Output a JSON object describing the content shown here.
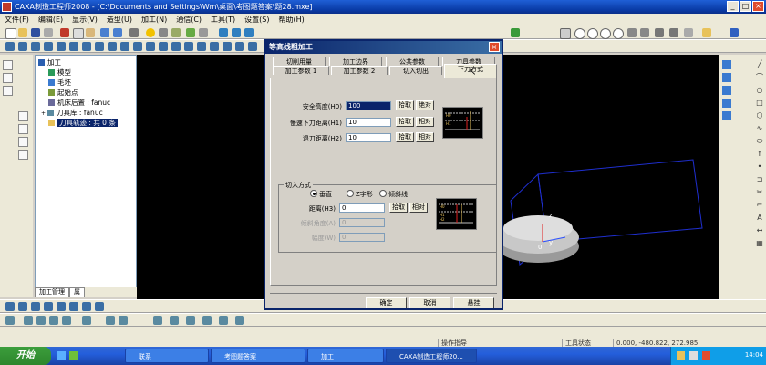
{
  "app": {
    "title": "CAXA制造工程师2008 - [C:\\Documents and Settings\\Wm\\桌面\\考图题答案\\题28.mxe]",
    "window_controls": [
      "_",
      "□",
      "×"
    ]
  },
  "menu": [
    "文件(F)",
    "编辑(E)",
    "显示(V)",
    "造型(U)",
    "加工(N)",
    "通信(C)",
    "工具(T)",
    "设置(S)",
    "帮助(H)"
  ],
  "tree": {
    "items": [
      {
        "label": "加工",
        "icon": "machining-icon"
      },
      {
        "label": "模型",
        "icon": "model-icon"
      },
      {
        "label": "毛坯",
        "icon": "stock-icon"
      },
      {
        "label": "起始点",
        "icon": "start-point-icon"
      },
      {
        "label": "机床后置 : fanuc",
        "icon": "machine-icon"
      },
      {
        "label": "刀具库 : fanuc",
        "icon": "tool-library-icon"
      },
      {
        "label": "刀具轨迹 : 共 0 条",
        "icon": "toolpath-icon"
      }
    ],
    "tabs": [
      "加工管理",
      "属"
    ]
  },
  "dialog": {
    "title": "等高线粗加工",
    "tabs_top": [
      "切削用量",
      "加工边界",
      "公共参数",
      "刀具参数"
    ],
    "tabs_bottom": [
      "加工参数 1",
      "加工参数 2",
      "切入切出",
      "下刀方式"
    ],
    "selected_tab": "下刀方式",
    "fields": [
      {
        "label": "安全高度(H0)",
        "value": "100",
        "buttons": [
          "拾取",
          "绝对"
        ]
      },
      {
        "label": "慢速下刀距离(H1)",
        "value": "10",
        "buttons": [
          "拾取",
          "相对"
        ]
      },
      {
        "label": "退刀距离(H2)",
        "value": "10",
        "buttons": [
          "拾取",
          "相对"
        ]
      }
    ],
    "cut_in": {
      "group_title": "切入方式",
      "options": [
        "垂直",
        "Z字形",
        "倾斜线"
      ],
      "selected": "垂直",
      "distance_label": "距离(H3)",
      "distance_value": "0",
      "distance_buttons": [
        "拾取",
        "相对"
      ],
      "angle_label": "倾斜角度(A)",
      "angle_value": "0",
      "pitch_label": "幅度(W)",
      "pitch_value": "0"
    },
    "preview_labels": {
      "top": [
        "H0",
        "H1"
      ],
      "bottom": [
        "H0",
        "H1",
        "H2"
      ]
    },
    "buttons": {
      "ok": "确定",
      "cancel": "取消",
      "hover": "悬挂"
    }
  },
  "status": {
    "prompt": "操作指导",
    "tool_state": "工具状态",
    "coords": "0.000, -480.822, 272.985"
  },
  "taskbar": {
    "start": "开始",
    "tasks": [
      "联系",
      "考图题答案",
      "加工",
      "CAXA制造工程师20..."
    ],
    "active_task": "CAXA制造工程师20...",
    "clock": "14:04"
  },
  "colors": {
    "title_blue": "#0a246a",
    "viewport": "#000000",
    "taskbar": "#245edb",
    "model_gray": "#bdbdbd",
    "bbox_blue": "#1f2fd0"
  }
}
